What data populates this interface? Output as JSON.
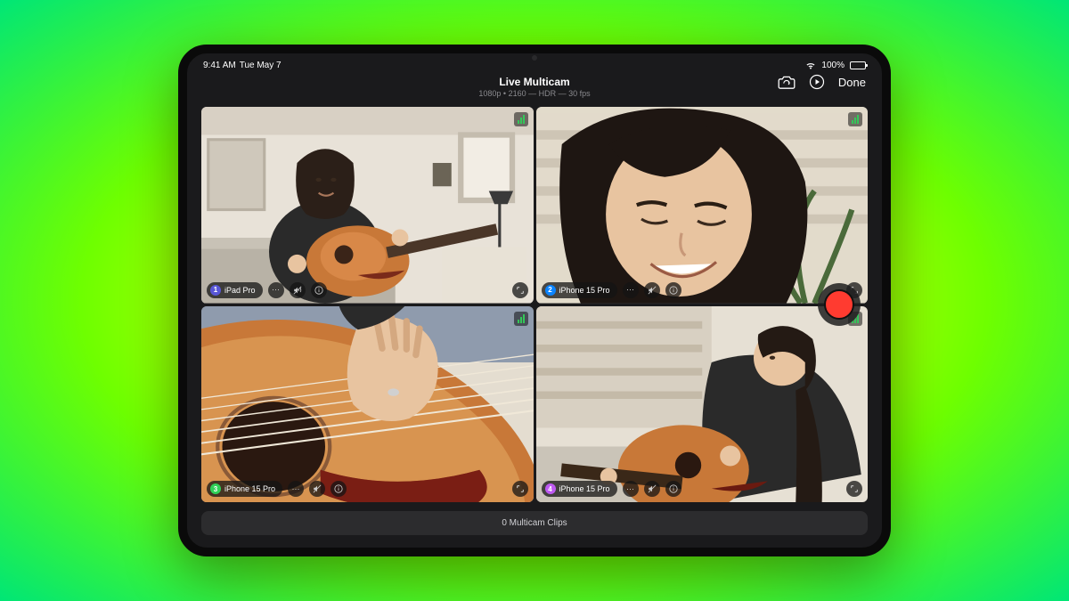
{
  "status": {
    "time": "9:41 AM",
    "date": "Tue May 7",
    "battery_pct": "100%"
  },
  "header": {
    "title": "Live Multicam",
    "subtitle": "1080p • 2160 — HDR — 30 fps",
    "done_label": "Done"
  },
  "cams": [
    {
      "label": "iPad Pro",
      "dot_color": "#5856d6"
    },
    {
      "label": "iPhone 15 Pro",
      "dot_color": "#0a84ff"
    },
    {
      "label": "iPhone 15 Pro",
      "dot_color": "#30d158"
    },
    {
      "label": "iPhone 15 Pro",
      "dot_color": "#bf5af2"
    }
  ],
  "footer": {
    "clips_label": "0 Multicam Clips"
  }
}
